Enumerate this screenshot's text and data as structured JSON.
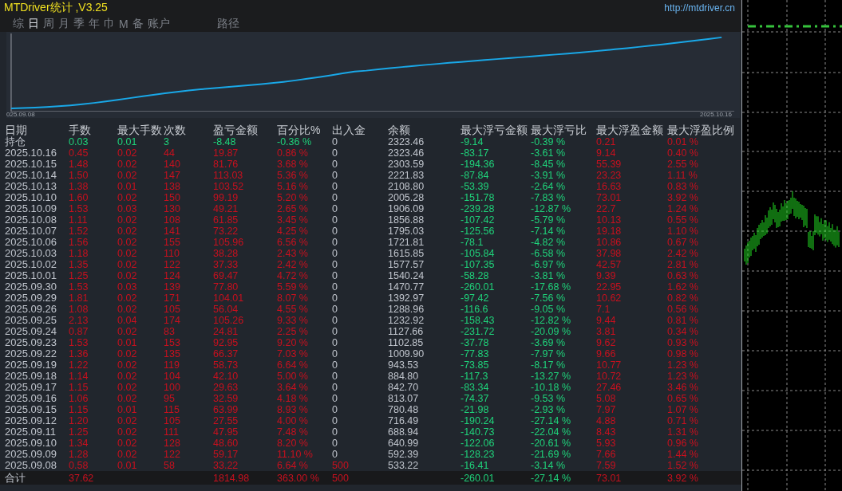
{
  "title": "MTDriver统计 ,V3.25",
  "url": "http://mtdriver.cn",
  "tabs": [
    {
      "label": "综",
      "selected": false
    },
    {
      "label": "日",
      "selected": true
    },
    {
      "label": "周",
      "selected": false
    },
    {
      "label": "月",
      "selected": false
    },
    {
      "label": "季",
      "selected": false
    },
    {
      "label": "年",
      "selected": false
    },
    {
      "label": "巾",
      "selected": false
    },
    {
      "label": "M",
      "selected": false
    },
    {
      "label": "备",
      "selected": false
    },
    {
      "label": "账户",
      "selected": false
    }
  ],
  "path_tab": {
    "label": "路径"
  },
  "equity_chart": {
    "start_label": "025.09.08",
    "end_label": "2025.10.16"
  },
  "table": {
    "columns": [
      "日期",
      "手数",
      "最大手数",
      "次数",
      "盈亏金额",
      "百分比%",
      "出入金",
      "余额",
      "最大浮亏金额",
      "最大浮亏比",
      "最大浮盈金额",
      "最大浮盈比例"
    ],
    "rows": [
      {
        "date": "持仓",
        "lots": "0.03",
        "max_lots": "0.01",
        "count": "3",
        "profit": "-8.48",
        "percent": "-0.36 %",
        "deposit": "0",
        "balance": "2323.46",
        "max_float_loss": "-9.14",
        "max_float_loss_pct": "-0.39 %",
        "max_float_profit": "0.21",
        "max_float_profit_pct": "0.01 %",
        "profitable": false,
        "deposit_made": false
      },
      {
        "date": "2025.10.16",
        "lots": "0.45",
        "max_lots": "0.02",
        "count": "44",
        "profit": "19.87",
        "percent": "0.86 %",
        "deposit": "0",
        "balance": "2323.46",
        "max_float_loss": "-83.17",
        "max_float_loss_pct": "-3.61 %",
        "max_float_profit": "9.14",
        "max_float_profit_pct": "0.40 %",
        "profitable": true,
        "deposit_made": false
      },
      {
        "date": "2025.10.15",
        "lots": "1.48",
        "max_lots": "0.02",
        "count": "140",
        "profit": "81.76",
        "percent": "3.68 %",
        "deposit": "0",
        "balance": "2303.59",
        "max_float_loss": "-194.36",
        "max_float_loss_pct": "-8.45 %",
        "max_float_profit": "55.39",
        "max_float_profit_pct": "2.55 %",
        "profitable": true,
        "deposit_made": false
      },
      {
        "date": "2025.10.14",
        "lots": "1.50",
        "max_lots": "0.02",
        "count": "147",
        "profit": "113.03",
        "percent": "5.36 %",
        "deposit": "0",
        "balance": "2221.83",
        "max_float_loss": "-87.84",
        "max_float_loss_pct": "-3.91 %",
        "max_float_profit": "23.23",
        "max_float_profit_pct": "1.11 %",
        "profitable": true,
        "deposit_made": false
      },
      {
        "date": "2025.10.13",
        "lots": "1.38",
        "max_lots": "0.01",
        "count": "138",
        "profit": "103.52",
        "percent": "5.16 %",
        "deposit": "0",
        "balance": "2108.80",
        "max_float_loss": "-53.39",
        "max_float_loss_pct": "-2.64 %",
        "max_float_profit": "16.63",
        "max_float_profit_pct": "0.83 %",
        "profitable": true,
        "deposit_made": false
      },
      {
        "date": "2025.10.10",
        "lots": "1.60",
        "max_lots": "0.02",
        "count": "150",
        "profit": "99.19",
        "percent": "5.20 %",
        "deposit": "0",
        "balance": "2005.28",
        "max_float_loss": "-151.78",
        "max_float_loss_pct": "-7.83 %",
        "max_float_profit": "73.01",
        "max_float_profit_pct": "3.92 %",
        "profitable": true,
        "deposit_made": false
      },
      {
        "date": "2025.10.09",
        "lots": "1.53",
        "max_lots": "0.03",
        "count": "130",
        "profit": "49.21",
        "percent": "2.65 %",
        "deposit": "0",
        "balance": "1906.09",
        "max_float_loss": "-239.28",
        "max_float_loss_pct": "-12.87 %",
        "max_float_profit": "22.7",
        "max_float_profit_pct": "1.24 %",
        "profitable": true,
        "deposit_made": false
      },
      {
        "date": "2025.10.08",
        "lots": "1.11",
        "max_lots": "0.02",
        "count": "108",
        "profit": "61.85",
        "percent": "3.45 %",
        "deposit": "0",
        "balance": "1856.88",
        "max_float_loss": "-107.42",
        "max_float_loss_pct": "-5.79 %",
        "max_float_profit": "10.13",
        "max_float_profit_pct": "0.55 %",
        "profitable": true,
        "deposit_made": false
      },
      {
        "date": "2025.10.07",
        "lots": "1.52",
        "max_lots": "0.02",
        "count": "141",
        "profit": "73.22",
        "percent": "4.25 %",
        "deposit": "0",
        "balance": "1795.03",
        "max_float_loss": "-125.56",
        "max_float_loss_pct": "-7.14 %",
        "max_float_profit": "19.18",
        "max_float_profit_pct": "1.10 %",
        "profitable": true,
        "deposit_made": false
      },
      {
        "date": "2025.10.06",
        "lots": "1.56",
        "max_lots": "0.02",
        "count": "155",
        "profit": "105.96",
        "percent": "6.56 %",
        "deposit": "0",
        "balance": "1721.81",
        "max_float_loss": "-78.1",
        "max_float_loss_pct": "-4.82 %",
        "max_float_profit": "10.86",
        "max_float_profit_pct": "0.67 %",
        "profitable": true,
        "deposit_made": false
      },
      {
        "date": "2025.10.03",
        "lots": "1.18",
        "max_lots": "0.02",
        "count": "110",
        "profit": "38.28",
        "percent": "2.43 %",
        "deposit": "0",
        "balance": "1615.85",
        "max_float_loss": "-105.84",
        "max_float_loss_pct": "-6.58 %",
        "max_float_profit": "37.98",
        "max_float_profit_pct": "2.42 %",
        "profitable": true,
        "deposit_made": false
      },
      {
        "date": "2025.10.02",
        "lots": "1.35",
        "max_lots": "0.02",
        "count": "122",
        "profit": "37.33",
        "percent": "2.42 %",
        "deposit": "0",
        "balance": "1577.57",
        "max_float_loss": "-107.35",
        "max_float_loss_pct": "-6.97 %",
        "max_float_profit": "42.57",
        "max_float_profit_pct": "2.81 %",
        "profitable": true,
        "deposit_made": false
      },
      {
        "date": "2025.10.01",
        "lots": "1.25",
        "max_lots": "0.02",
        "count": "124",
        "profit": "69.47",
        "percent": "4.72 %",
        "deposit": "0",
        "balance": "1540.24",
        "max_float_loss": "-58.28",
        "max_float_loss_pct": "-3.81 %",
        "max_float_profit": "9.39",
        "max_float_profit_pct": "0.63 %",
        "profitable": true,
        "deposit_made": false
      },
      {
        "date": "2025.09.30",
        "lots": "1.53",
        "max_lots": "0.03",
        "count": "139",
        "profit": "77.80",
        "percent": "5.59 %",
        "deposit": "0",
        "balance": "1470.77",
        "max_float_loss": "-260.01",
        "max_float_loss_pct": "-17.68 %",
        "max_float_profit": "22.95",
        "max_float_profit_pct": "1.62 %",
        "profitable": true,
        "deposit_made": false
      },
      {
        "date": "2025.09.29",
        "lots": "1.81",
        "max_lots": "0.02",
        "count": "171",
        "profit": "104.01",
        "percent": "8.07 %",
        "deposit": "0",
        "balance": "1392.97",
        "max_float_loss": "-97.42",
        "max_float_loss_pct": "-7.56 %",
        "max_float_profit": "10.62",
        "max_float_profit_pct": "0.82 %",
        "profitable": true,
        "deposit_made": false
      },
      {
        "date": "2025.09.26",
        "lots": "1.08",
        "max_lots": "0.02",
        "count": "105",
        "profit": "56.04",
        "percent": "4.55 %",
        "deposit": "0",
        "balance": "1288.96",
        "max_float_loss": "-116.6",
        "max_float_loss_pct": "-9.05 %",
        "max_float_profit": "7.1",
        "max_float_profit_pct": "0.56 %",
        "profitable": true,
        "deposit_made": false
      },
      {
        "date": "2025.09.25",
        "lots": "2.13",
        "max_lots": "0.04",
        "count": "174",
        "profit": "105.26",
        "percent": "9.33 %",
        "deposit": "0",
        "balance": "1232.92",
        "max_float_loss": "-158.43",
        "max_float_loss_pct": "-12.82 %",
        "max_float_profit": "9.44",
        "max_float_profit_pct": "0.81 %",
        "profitable": true,
        "deposit_made": false
      },
      {
        "date": "2025.09.24",
        "lots": "0.87",
        "max_lots": "0.02",
        "count": "83",
        "profit": "24.81",
        "percent": "2.25 %",
        "deposit": "0",
        "balance": "1127.66",
        "max_float_loss": "-231.72",
        "max_float_loss_pct": "-20.09 %",
        "max_float_profit": "3.81",
        "max_float_profit_pct": "0.34 %",
        "profitable": true,
        "deposit_made": false
      },
      {
        "date": "2025.09.23",
        "lots": "1.53",
        "max_lots": "0.01",
        "count": "153",
        "profit": "92.95",
        "percent": "9.20 %",
        "deposit": "0",
        "balance": "1102.85",
        "max_float_loss": "-37.78",
        "max_float_loss_pct": "-3.69 %",
        "max_float_profit": "9.62",
        "max_float_profit_pct": "0.93 %",
        "profitable": true,
        "deposit_made": false
      },
      {
        "date": "2025.09.22",
        "lots": "1.36",
        "max_lots": "0.02",
        "count": "135",
        "profit": "66.37",
        "percent": "7.03 %",
        "deposit": "0",
        "balance": "1009.90",
        "max_float_loss": "-77.83",
        "max_float_loss_pct": "-7.97 %",
        "max_float_profit": "9.66",
        "max_float_profit_pct": "0.98 %",
        "profitable": true,
        "deposit_made": false
      },
      {
        "date": "2025.09.19",
        "lots": "1.22",
        "max_lots": "0.02",
        "count": "119",
        "profit": "58.73",
        "percent": "6.64 %",
        "deposit": "0",
        "balance": "943.53",
        "max_float_loss": "-73.85",
        "max_float_loss_pct": "-8.17 %",
        "max_float_profit": "10.77",
        "max_float_profit_pct": "1.23 %",
        "profitable": true,
        "deposit_made": false
      },
      {
        "date": "2025.09.18",
        "lots": "1.14",
        "max_lots": "0.02",
        "count": "104",
        "profit": "42.10",
        "percent": "5.00 %",
        "deposit": "0",
        "balance": "884.80",
        "max_float_loss": "-117.3",
        "max_float_loss_pct": "-13.27 %",
        "max_float_profit": "10.72",
        "max_float_profit_pct": "1.23 %",
        "profitable": true,
        "deposit_made": false
      },
      {
        "date": "2025.09.17",
        "lots": "1.15",
        "max_lots": "0.02",
        "count": "100",
        "profit": "29.63",
        "percent": "3.64 %",
        "deposit": "0",
        "balance": "842.70",
        "max_float_loss": "-83.34",
        "max_float_loss_pct": "-10.18 %",
        "max_float_profit": "27.46",
        "max_float_profit_pct": "3.46 %",
        "profitable": true,
        "deposit_made": false
      },
      {
        "date": "2025.09.16",
        "lots": "1.06",
        "max_lots": "0.02",
        "count": "95",
        "profit": "32.59",
        "percent": "4.18 %",
        "deposit": "0",
        "balance": "813.07",
        "max_float_loss": "-74.37",
        "max_float_loss_pct": "-9.53 %",
        "max_float_profit": "5.08",
        "max_float_profit_pct": "0.65 %",
        "profitable": true,
        "deposit_made": false
      },
      {
        "date": "2025.09.15",
        "lots": "1.15",
        "max_lots": "0.01",
        "count": "115",
        "profit": "63.99",
        "percent": "8.93 %",
        "deposit": "0",
        "balance": "780.48",
        "max_float_loss": "-21.98",
        "max_float_loss_pct": "-2.93 %",
        "max_float_profit": "7.97",
        "max_float_profit_pct": "1.07 %",
        "profitable": true,
        "deposit_made": false
      },
      {
        "date": "2025.09.12",
        "lots": "1.20",
        "max_lots": "0.02",
        "count": "105",
        "profit": "27.55",
        "percent": "4.00 %",
        "deposit": "0",
        "balance": "716.49",
        "max_float_loss": "-190.24",
        "max_float_loss_pct": "-27.14 %",
        "max_float_profit": "4.88",
        "max_float_profit_pct": "0.71 %",
        "profitable": true,
        "deposit_made": false
      },
      {
        "date": "2025.09.11",
        "lots": "1.25",
        "max_lots": "0.02",
        "count": "111",
        "profit": "47.95",
        "percent": "7.48 %",
        "deposit": "0",
        "balance": "688.94",
        "max_float_loss": "-140.73",
        "max_float_loss_pct": "-22.04 %",
        "max_float_profit": "8.43",
        "max_float_profit_pct": "1.31 %",
        "profitable": true,
        "deposit_made": false
      },
      {
        "date": "2025.09.10",
        "lots": "1.34",
        "max_lots": "0.02",
        "count": "128",
        "profit": "48.60",
        "percent": "8.20 %",
        "deposit": "0",
        "balance": "640.99",
        "max_float_loss": "-122.06",
        "max_float_loss_pct": "-20.61 %",
        "max_float_profit": "5.93",
        "max_float_profit_pct": "0.96 %",
        "profitable": true,
        "deposit_made": false
      },
      {
        "date": "2025.09.09",
        "lots": "1.28",
        "max_lots": "0.02",
        "count": "122",
        "profit": "59.17",
        "percent": "11.10 %",
        "deposit": "0",
        "balance": "592.39",
        "max_float_loss": "-128.23",
        "max_float_loss_pct": "-21.69 %",
        "max_float_profit": "7.66",
        "max_float_profit_pct": "1.44 %",
        "profitable": true,
        "deposit_made": false
      },
      {
        "date": "2025.09.08",
        "lots": "0.58",
        "max_lots": "0.01",
        "count": "58",
        "profit": "33.22",
        "percent": "6.64 %",
        "deposit": "500",
        "balance": "533.22",
        "max_float_loss": "-16.41",
        "max_float_loss_pct": "-3.14 %",
        "max_float_profit": "7.59",
        "max_float_profit_pct": "1.52 %",
        "profitable": true,
        "deposit_made": true
      }
    ],
    "total": {
      "date": "合计",
      "lots": "37.62",
      "profit": "1814.98",
      "percent": "363.00 %",
      "deposit": "500",
      "max_float_loss": "-260.01",
      "max_float_loss_pct": "-27.14 %",
      "max_float_profit": "73.01",
      "max_float_profit_pct": "3.92 %",
      "profitable": true,
      "deposit_made": true
    }
  }
}
